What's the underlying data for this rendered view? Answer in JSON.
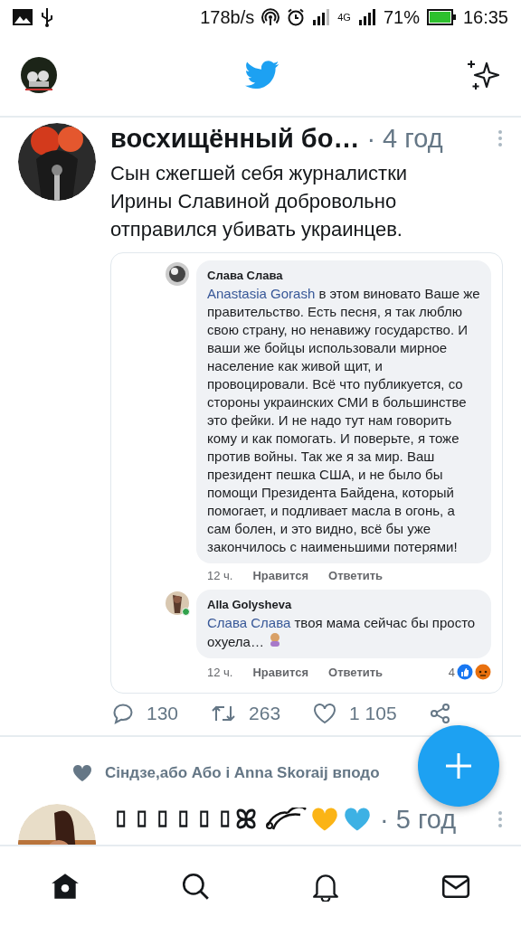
{
  "status_bar": {
    "net_speed": "178b/s",
    "network_type": "4G",
    "battery": "71%",
    "time": "16:35"
  },
  "tweets": [
    {
      "kind": "tweet",
      "author": "восхищённый бо…",
      "time": "· 4 год",
      "text": "Сын сжегшей себя журналистки Ирины Славиной добровольно отправился убивать украинцев.",
      "embedded": {
        "comments": [
          {
            "author": "Слава Слава",
            "mention": "Anastasia Gorash",
            "text": "в этом виновато Ваше же правительство. Есть песня, я так люблю свою страну, но ненавижу государство. И ваши же бойцы использовали мирное население как живой щит, и провоцировали. Всё что публикуется, со стороны украинских СМИ в большинстве это фейки. И не надо тут нам говорить кому и как помогать. И поверьте, я тоже против войны. Так же я за мир. Ваш президент пешка США, и не было бы помощи Президента Байдена, который помогает, и подливает масла в огонь, а сам болен, и это видно, всё бы уже закончилось с наименьшими потерями!",
            "time": "12 ч.",
            "like_label": "Нравится",
            "reply_label": "Ответить",
            "online": false
          },
          {
            "author": "Alla Golysheva",
            "mention": "Слава Слава",
            "text": "твоя мама сейчас бы просто охуела…",
            "time": "12 ч.",
            "like_label": "Нравится",
            "reply_label": "Ответить",
            "reaction_count": "4",
            "online": true
          }
        ]
      },
      "actions": {
        "replies": "130",
        "retweets": "263",
        "likes": "1 105"
      }
    },
    {
      "kind": "liked",
      "social_context": "Сіндзе,або Або і Anna Skoraij вподо",
      "author": "▯▯▯▯▯▯ꕤ",
      "time": "· 5 год"
    }
  ],
  "nav": [
    {
      "kind": "home",
      "selected": true
    },
    {
      "kind": "search",
      "selected": false
    },
    {
      "kind": "notifications",
      "selected": false
    },
    {
      "kind": "messages",
      "selected": false
    }
  ]
}
